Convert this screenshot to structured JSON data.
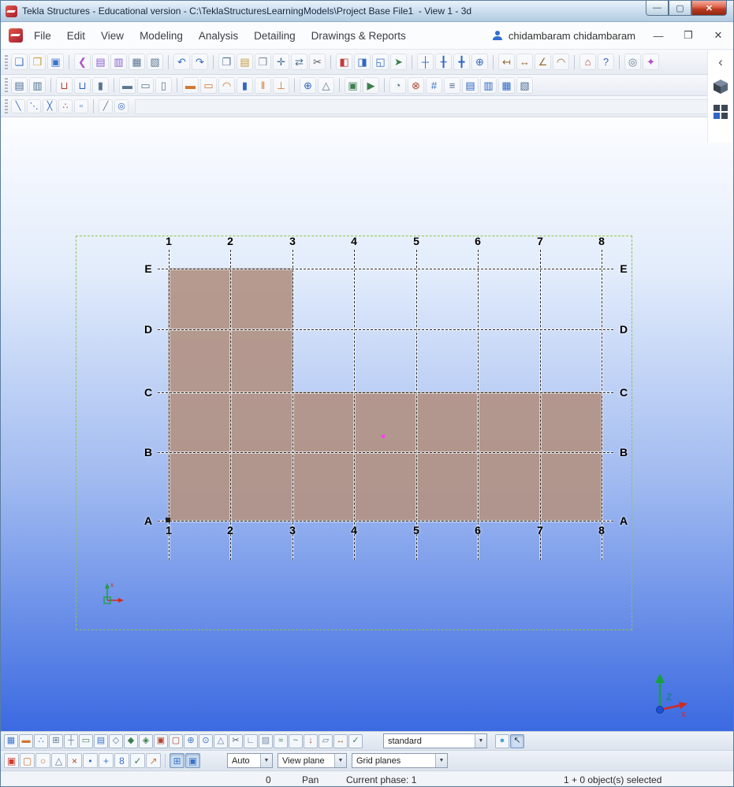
{
  "window": {
    "title": "Tekla Structures - Educational version - C:\\TeklaStructuresLearningModels\\Project Base File1  - View 1 - 3d",
    "controls": {
      "minimize": "—",
      "maximize": "▢",
      "close": "✕"
    }
  },
  "glyphs": {
    "dropdown": "▼",
    "chevron_left": "‹"
  },
  "menubar": {
    "items": [
      "File",
      "Edit",
      "View",
      "Modeling",
      "Analysis",
      "Detailing",
      "Drawings & Reports"
    ],
    "user": "chidambaram chidambaram",
    "window_controls": {
      "minimize": "—",
      "restore": "❐",
      "close": "✕"
    }
  },
  "toolbars": {
    "main": [
      {
        "name": "new-model-icon",
        "glyph": "❏",
        "color": "#3a73c9"
      },
      {
        "name": "open-model-icon",
        "glyph": "❒",
        "color": "#c79b3b"
      },
      {
        "name": "save-model-icon",
        "glyph": "▣",
        "color": "#3a73c9"
      },
      {
        "sep": true
      },
      {
        "name": "fetch-icon",
        "glyph": "❮",
        "color": "#b14fc9"
      },
      {
        "name": "properties-pane-icon",
        "glyph": "▤",
        "color": "#8a5fd0"
      },
      {
        "name": "organizer-icon",
        "glyph": "▥",
        "color": "#8a5fd0"
      },
      {
        "name": "catalogs-icon",
        "glyph": "▦",
        "color": "#5b7693"
      },
      {
        "name": "applications-icon",
        "glyph": "▧",
        "color": "#5b7693"
      },
      {
        "sep": true
      },
      {
        "name": "undo-icon",
        "glyph": "↶",
        "color": "#2f66c4"
      },
      {
        "name": "redo-icon",
        "glyph": "↷",
        "color": "#2f66c4"
      },
      {
        "sep": true
      },
      {
        "name": "copy-icon",
        "glyph": "❐",
        "color": "#4a6d96"
      },
      {
        "name": "paste-icon",
        "glyph": "▤",
        "color": "#c79b3b"
      },
      {
        "name": "copy-special-icon",
        "glyph": "❒",
        "color": "#7a8fa8"
      },
      {
        "name": "move-icon",
        "glyph": "✛",
        "color": "#4a6d96"
      },
      {
        "name": "move-special-icon",
        "glyph": "⇄",
        "color": "#4a6d96"
      },
      {
        "name": "cut-icon",
        "glyph": "✂",
        "color": "#50585f"
      },
      {
        "sep": true
      },
      {
        "name": "create-view-icon",
        "glyph": "◧",
        "color": "#c23b3b"
      },
      {
        "name": "named-views-icon",
        "glyph": "◨",
        "color": "#2f66c4"
      },
      {
        "name": "fit-work-area-icon",
        "glyph": "◱",
        "color": "#2f66c4"
      },
      {
        "name": "flight-mode-icon",
        "glyph": "➤",
        "color": "#3f7d4f"
      },
      {
        "sep": true
      },
      {
        "name": "create-point-icon",
        "glyph": "┼",
        "color": "#2f66c4"
      },
      {
        "name": "point-on-line-icon",
        "glyph": "╂",
        "color": "#2f66c4"
      },
      {
        "name": "point-intersection-icon",
        "glyph": "╋",
        "color": "#2f66c4"
      },
      {
        "name": "bolt-point-icon",
        "glyph": "⊕",
        "color": "#2f66c4"
      },
      {
        "sep": true
      },
      {
        "name": "measure-distance-icon",
        "glyph": "↤",
        "color": "#9a6a2f"
      },
      {
        "name": "measure-horizontal-icon",
        "glyph": "↔",
        "color": "#9a6a2f"
      },
      {
        "name": "measure-angle-icon",
        "glyph": "∠",
        "color": "#9a6a2f"
      },
      {
        "name": "measure-arc-icon",
        "glyph": "◠",
        "color": "#9a6a2f"
      },
      {
        "sep": true
      },
      {
        "name": "auto-connection-icon",
        "glyph": "⌂",
        "color": "#b1452f"
      },
      {
        "name": "inquire-object-icon",
        "glyph": "?",
        "color": "#2f66c4"
      },
      {
        "sep": true
      },
      {
        "name": "spinning-view-icon",
        "glyph": "◎",
        "color": "#5b7693"
      },
      {
        "name": "point-cloud-icon",
        "glyph": "✦",
        "color": "#b14fc9"
      }
    ],
    "secondary": [
      {
        "name": "open-drawing-list-icon",
        "glyph": "▤",
        "color": "#4a6d96"
      },
      {
        "name": "print-icon",
        "glyph": "▥",
        "color": "#4a6d96"
      },
      {
        "sep": true
      },
      {
        "name": "create-pad-footing-icon",
        "glyph": "⊔",
        "color": "#b1452f"
      },
      {
        "name": "create-strip-footing-icon",
        "glyph": "⊔",
        "color": "#2f66c4"
      },
      {
        "name": "create-concrete-column-icon",
        "glyph": "▮",
        "color": "#5b7693"
      },
      {
        "sep": true
      },
      {
        "name": "create-concrete-beam-icon",
        "glyph": "▬",
        "color": "#5b7693"
      },
      {
        "name": "create-concrete-slab-icon",
        "glyph": "▭",
        "color": "#5b7693"
      },
      {
        "name": "create-concrete-panel-icon",
        "glyph": "▯",
        "color": "#5b7693"
      },
      {
        "sep": true
      },
      {
        "name": "create-steel-beam-icon",
        "glyph": "▬",
        "color": "#d2762f"
      },
      {
        "name": "create-polybeam-icon",
        "glyph": "▭",
        "color": "#d2762f"
      },
      {
        "name": "create-curved-beam-icon",
        "glyph": "◠",
        "color": "#d2762f"
      },
      {
        "name": "create-steel-column-icon",
        "glyph": "▮",
        "color": "#2f66c4"
      },
      {
        "name": "create-twin-profile-icon",
        "glyph": "‖",
        "color": "#d2762f"
      },
      {
        "name": "create-orthogonal-beam-icon",
        "glyph": "⊥",
        "color": "#d2762f"
      },
      {
        "sep": true
      },
      {
        "name": "create-bolts-icon",
        "glyph": "⊕",
        "color": "#2f66c4"
      },
      {
        "name": "create-weld-icon",
        "glyph": "△",
        "color": "#5b7693"
      },
      {
        "sep": true
      },
      {
        "name": "component-catalog-icon",
        "glyph": "▣",
        "color": "#3f7d4f"
      },
      {
        "name": "run-macro-icon",
        "glyph": "▶",
        "color": "#3f7d4f"
      },
      {
        "sep": true
      },
      {
        "name": "phase-manager-icon",
        "glyph": "◔",
        "color": "#5b7693"
      },
      {
        "name": "clash-check-icon",
        "glyph": "⊗",
        "color": "#b1452f"
      },
      {
        "name": "numbering-icon",
        "glyph": "#",
        "color": "#2f66c4"
      },
      {
        "name": "create-report-icon",
        "glyph": "≡",
        "color": "#4a6d96"
      },
      {
        "name": "drawing-list-icon",
        "glyph": "▤",
        "color": "#2f66c4"
      },
      {
        "name": "create-ga-drawing-icon",
        "glyph": "▥",
        "color": "#2f66c4"
      },
      {
        "name": "open-drawing-icon",
        "glyph": "▦",
        "color": "#2f66c4"
      },
      {
        "name": "print-drawings-icon",
        "glyph": "▧",
        "color": "#4a6d96"
      }
    ],
    "construction": [
      {
        "name": "construction-line-icon",
        "glyph": "╲",
        "color": "#2f66c4"
      },
      {
        "name": "construction-line-segments-icon",
        "glyph": "⋱",
        "color": "#2f66c4"
      },
      {
        "name": "construction-cross-lines-icon",
        "glyph": "╳",
        "color": "#2f66c4"
      },
      {
        "name": "construction-points-line-icon",
        "glyph": "∴",
        "color": "#b1452f"
      },
      {
        "name": "construction-point-box-icon",
        "glyph": "▫",
        "color": "#2f66c4"
      },
      {
        "sep": true
      },
      {
        "name": "reference-line-icon",
        "glyph": "╱",
        "color": "#5b7693"
      },
      {
        "name": "construction-circle-icon",
        "glyph": "◎",
        "color": "#2f66c4"
      }
    ]
  },
  "viewport": {
    "grid": {
      "columns": [
        "1",
        "2",
        "3",
        "4",
        "5",
        "6",
        "7",
        "8"
      ],
      "rows": [
        "E",
        "D",
        "C",
        "B",
        "A"
      ]
    },
    "colors": {
      "slab_fill": "rgba(178,147,134,0.92)",
      "slab_stroke": "rgba(92,72,62,0.85)",
      "selection_box": "#8fc14f",
      "bg_top": "#fcfdff",
      "bg_bottom": "#3b6ae1"
    }
  },
  "selection_toolbar": {
    "filter_value": "standard",
    "icons": [
      {
        "name": "select-all-icon",
        "glyph": "▦",
        "color": "#3a73c9"
      },
      {
        "name": "select-parts-icon",
        "glyph": "▬",
        "color": "#d2762f"
      },
      {
        "name": "select-points-icon",
        "glyph": "∴",
        "color": "#3a73c9"
      },
      {
        "name": "select-grids-icon",
        "glyph": "⊞",
        "color": "#5b7693"
      },
      {
        "name": "select-grid-lines-icon",
        "glyph": "┼",
        "color": "#5b7693"
      },
      {
        "name": "select-views-icon",
        "glyph": "▭",
        "color": "#3f7d4f"
      },
      {
        "name": "select-drawings-icon",
        "glyph": "▤",
        "color": "#3a73c9"
      },
      {
        "name": "select-plane-icon",
        "glyph": "◇",
        "color": "#5b7693"
      },
      {
        "name": "select-components-icon",
        "glyph": "◆",
        "color": "#3f7d4f"
      },
      {
        "name": "select-objects-in-components-icon",
        "glyph": "◈",
        "color": "#3f7d4f"
      },
      {
        "name": "select-assemblies-icon",
        "glyph": "▣",
        "color": "#b1452f"
      },
      {
        "name": "select-objects-in-assemblies-icon",
        "glyph": "▢",
        "color": "#b1452f"
      },
      {
        "name": "select-bolts-icon",
        "glyph": "⊕",
        "color": "#3a73c9"
      },
      {
        "name": "select-single-bolts-icon",
        "glyph": "⊙",
        "color": "#3a73c9"
      },
      {
        "name": "select-welds-icon",
        "glyph": "△",
        "color": "#5b7693"
      },
      {
        "name": "select-cuts-icon",
        "glyph": "✂",
        "color": "#50585f"
      },
      {
        "name": "select-fittings-icon",
        "glyph": "∟",
        "color": "#5b7693"
      },
      {
        "name": "select-surfaces-icon",
        "glyph": "▨",
        "color": "#7a8fa8"
      },
      {
        "name": "select-rebar-groups-icon",
        "glyph": "≈",
        "color": "#3f7d4f"
      },
      {
        "name": "select-single-rebar-icon",
        "glyph": "~",
        "color": "#3f7d4f"
      },
      {
        "name": "select-loads-icon",
        "glyph": "↓",
        "color": "#b1452f"
      },
      {
        "name": "select-planes-icon",
        "glyph": "▱",
        "color": "#5b7693"
      },
      {
        "name": "select-distances-icon",
        "glyph": "↔",
        "color": "#9a6a2f"
      },
      {
        "name": "select-tasks-icon",
        "glyph": "✓",
        "color": "#3f7d4f"
      }
    ],
    "right_icons": [
      {
        "name": "rendering-options-icon",
        "glyph": "●",
        "color": "#4aa3d8"
      },
      {
        "name": "drag-and-drop-icon",
        "glyph": "↖",
        "color": "#2b3b4c",
        "pressed": true
      }
    ]
  },
  "snap_toolbar": {
    "combo1": "Auto",
    "combo2": "View plane",
    "combo3": "Grid planes",
    "icons": [
      {
        "name": "snap-reference-points-icon",
        "glyph": "▣",
        "color": "#d23b2f"
      },
      {
        "name": "snap-geometry-points-icon",
        "glyph": "▢",
        "color": "#d2762f"
      },
      {
        "name": "snap-any-position-icon",
        "glyph": "○",
        "color": "#d2762f"
      },
      {
        "name": "snap-mid-points-icon",
        "glyph": "△",
        "color": "#5b7693"
      },
      {
        "name": "snap-off-icon",
        "glyph": "×",
        "color": "#b1452f"
      },
      {
        "name": "snap-points-icon",
        "glyph": "•",
        "color": "#3a73c9"
      },
      {
        "name": "snap-line-ends-icon",
        "glyph": "+",
        "color": "#3a73c9"
      },
      {
        "name": "snap-numeric-icon",
        "glyph": "8",
        "color": "#3a73c9"
      },
      {
        "name": "snap-ok-icon",
        "glyph": "✓",
        "color": "#3f7d4f"
      },
      {
        "name": "snap-arrow-icon",
        "glyph": "↗",
        "color": "#d2762f"
      },
      {
        "sep": true
      },
      {
        "name": "ortho-toggle-icon",
        "glyph": "⊞",
        "color": "#3a73c9",
        "pressed": true
      },
      {
        "name": "plane-lock-toggle-icon",
        "glyph": "▣",
        "color": "#3a73c9",
        "pressed": true
      }
    ]
  },
  "statusbar": {
    "coordinate": "0",
    "mode": "Pan",
    "phase": "Current phase: 1",
    "selected": "1 + 0 object(s) selected"
  }
}
